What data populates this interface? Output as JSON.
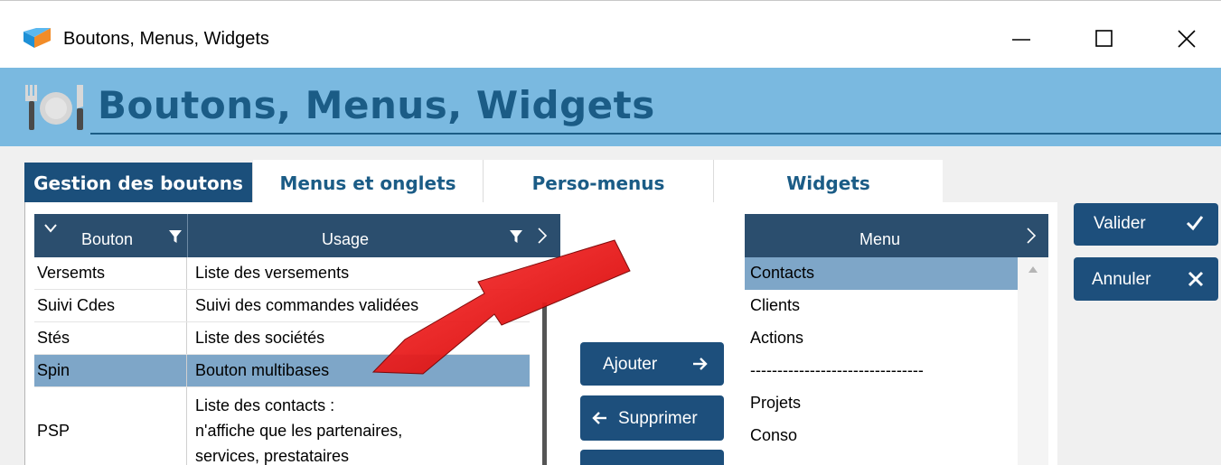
{
  "window": {
    "title": "Boutons, Menus, Widgets",
    "controls": [
      "minimize",
      "maximize",
      "close"
    ]
  },
  "header": {
    "title": "Boutons, Menus, Widgets",
    "icon": "dining-icon"
  },
  "tabs": [
    {
      "label": "Gestion des boutons",
      "active": true
    },
    {
      "label": "Menus et onglets",
      "active": false
    },
    {
      "label": "Perso-menus",
      "active": false
    },
    {
      "label": "Widgets",
      "active": false
    }
  ],
  "buttons_grid": {
    "columns": [
      "Bouton",
      "Usage"
    ],
    "rows": [
      {
        "bouton": "Versemts",
        "usage": [
          "Liste des versements"
        ],
        "selected": false
      },
      {
        "bouton": "Suivi Cdes",
        "usage": [
          "Suivi des commandes validées"
        ],
        "selected": false
      },
      {
        "bouton": "Stés",
        "usage": [
          "Liste des sociétés"
        ],
        "selected": false
      },
      {
        "bouton": "Spin",
        "usage": [
          "Bouton multibases"
        ],
        "selected": true
      },
      {
        "bouton": "PSP",
        "usage": [
          "Liste des contacts :",
          "n'affiche que les partenaires,",
          "services, prestataires"
        ],
        "selected": false
      }
    ]
  },
  "actions": {
    "add": "Ajouter",
    "remove": "Supprimer"
  },
  "menu_list": {
    "header": "Menu",
    "items": [
      {
        "label": "Contacts",
        "selected": true
      },
      {
        "label": "Clients",
        "selected": false
      },
      {
        "label": "Actions",
        "selected": false
      },
      {
        "label": "--------------------------------",
        "selected": false
      },
      {
        "label": "Projets",
        "selected": false
      },
      {
        "label": "Conso",
        "selected": false
      }
    ]
  },
  "dialog": {
    "ok": "Valider",
    "cancel": "Annuler"
  },
  "colors": {
    "header_band": "#7ab9e0",
    "accent": "#1b4f7b",
    "selection": "#7ea6c8",
    "arrow": "#e01010"
  }
}
